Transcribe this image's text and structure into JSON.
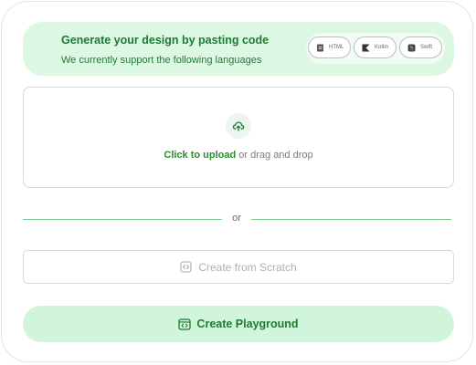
{
  "banner": {
    "title": "Generate your design by pasting code",
    "subtitle": "We currently support the following languages",
    "languages": [
      {
        "label": "HTML",
        "icon": "html-file-icon"
      },
      {
        "label": "Kotlin",
        "icon": "kotlin-icon"
      },
      {
        "label": "Swift",
        "icon": "swift-icon"
      }
    ]
  },
  "upload": {
    "icon": "cloud-upload-icon",
    "link_label": "Click to upload",
    "rest_label": "or drag and drop"
  },
  "divider": {
    "label": "or"
  },
  "scratch_button": {
    "icon": "code-brackets-icon",
    "label": "Create from Scratch"
  },
  "playground_button": {
    "icon": "code-window-icon",
    "label": "Create Playground"
  },
  "colors": {
    "accent_green": "#1d7a35",
    "banner_bg": "#dcf8e3",
    "button_bg": "#d1f5da",
    "divider": "#7cc98a"
  }
}
